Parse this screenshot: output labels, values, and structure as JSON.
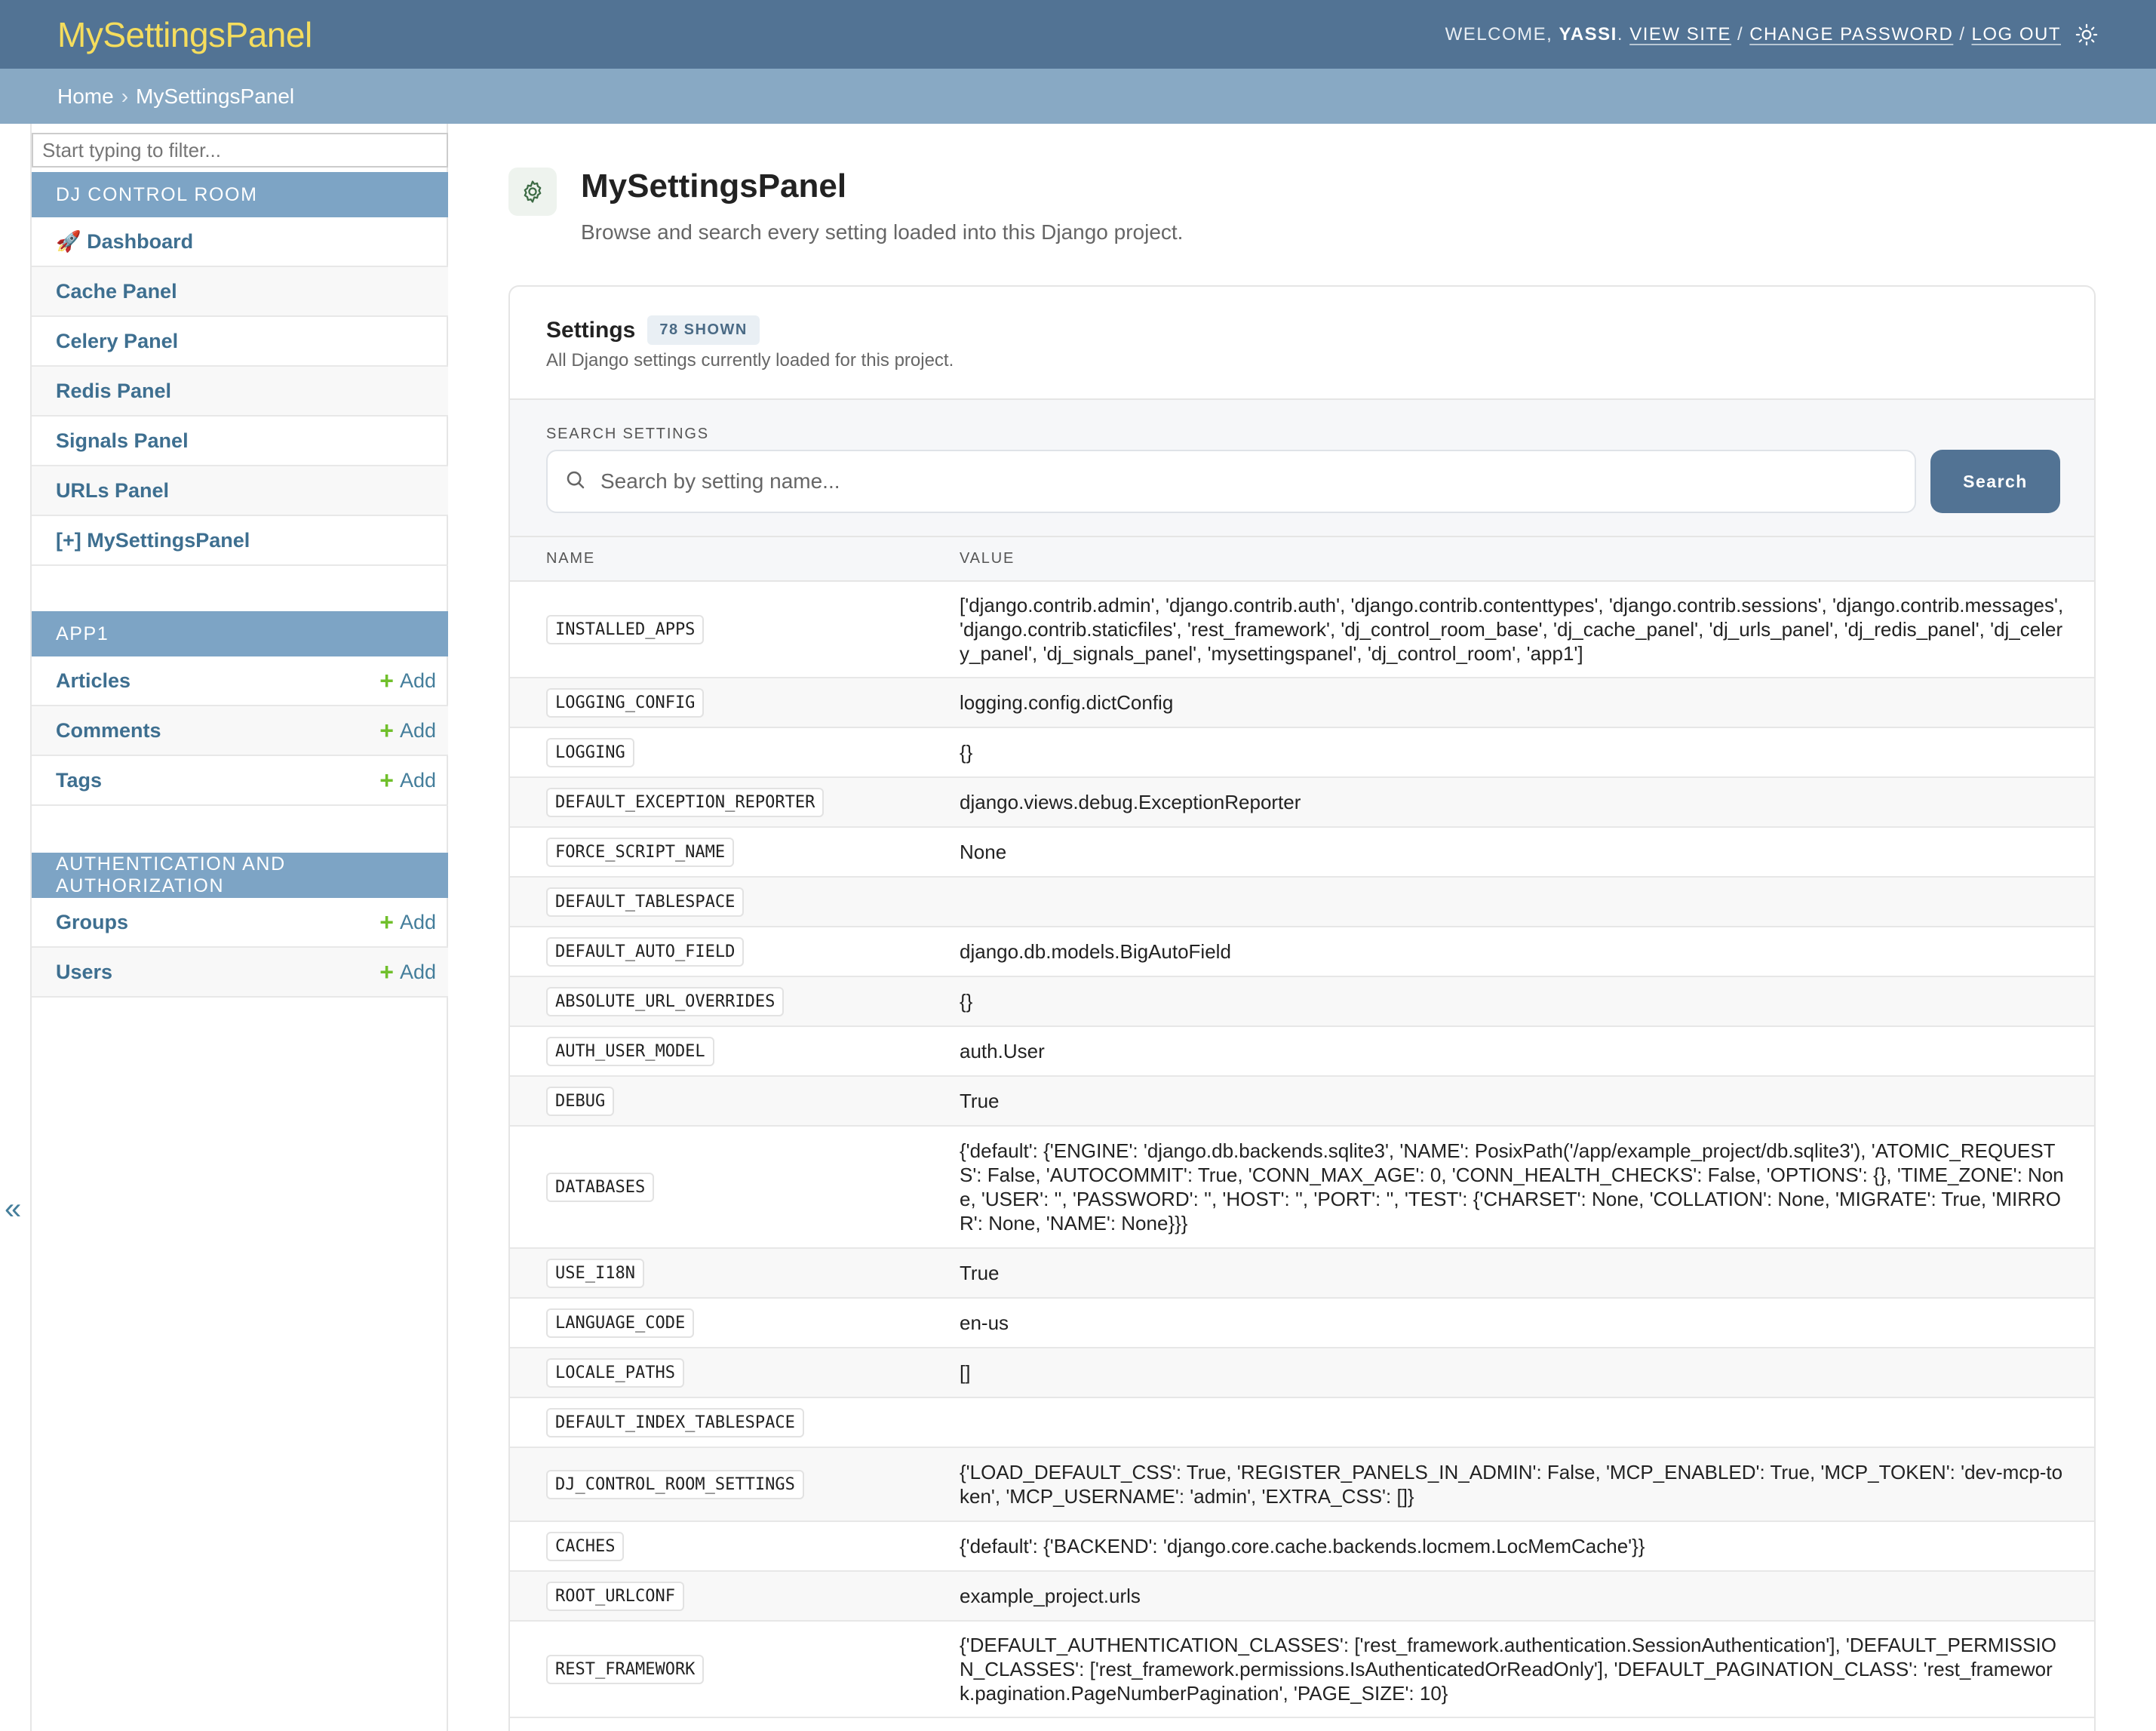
{
  "header": {
    "brand": "MySettingsPanel",
    "welcome_prefix": "WELCOME,",
    "username": "YASSI",
    "view_site": "VIEW SITE",
    "change_password": "CHANGE PASSWORD",
    "log_out": "LOG OUT",
    "separator": "/",
    "theme_icon": "sun-icon"
  },
  "breadcrumbs": {
    "home": "Home",
    "separator": "›",
    "current": "MySettingsPanel"
  },
  "sidebar": {
    "filter_placeholder": "Start typing to filter...",
    "collapse_label": "«",
    "modules": [
      {
        "caption": "DJ CONTROL ROOM",
        "items": [
          {
            "label": "🚀 Dashboard"
          },
          {
            "label": "Cache Panel"
          },
          {
            "label": "Celery Panel"
          },
          {
            "label": "Redis Panel"
          },
          {
            "label": "Signals Panel"
          },
          {
            "label": "URLs Panel"
          },
          {
            "label": "[+] MySettingsPanel"
          }
        ]
      },
      {
        "caption": "APP1",
        "items": [
          {
            "label": "Articles",
            "add": "Add"
          },
          {
            "label": "Comments",
            "add": "Add"
          },
          {
            "label": "Tags",
            "add": "Add"
          }
        ]
      },
      {
        "caption": "AUTHENTICATION AND AUTHORIZATION",
        "items": [
          {
            "label": "Groups",
            "add": "Add"
          },
          {
            "label": "Users",
            "add": "Add"
          }
        ]
      }
    ],
    "add_plus": "+"
  },
  "main": {
    "title": "MySettingsPanel",
    "subtitle": "Browse and search every setting loaded into this Django project.",
    "icon": "gear-icon",
    "card": {
      "title": "Settings",
      "badge": "78 SHOWN",
      "description": "All Django settings currently loaded for this project.",
      "search_label": "SEARCH SETTINGS",
      "search_placeholder": "Search by setting name...",
      "search_button": "Search",
      "columns": {
        "name": "NAME",
        "value": "VALUE"
      },
      "rows": [
        {
          "name": "INSTALLED_APPS",
          "value": "['django.contrib.admin', 'django.contrib.auth', 'django.contrib.contenttypes', 'django.contrib.sessions', 'django.contrib.messages', 'django.contrib.staticfiles', 'rest_framework', 'dj_control_room_base', 'dj_cache_panel', 'dj_urls_panel', 'dj_redis_panel', 'dj_celery_panel', 'dj_signals_panel', 'mysettingspanel', 'dj_control_room', 'app1']"
        },
        {
          "name": "LOGGING_CONFIG",
          "value": "logging.config.dictConfig"
        },
        {
          "name": "LOGGING",
          "value": "{}"
        },
        {
          "name": "DEFAULT_EXCEPTION_REPORTER",
          "value": "django.views.debug.ExceptionReporter"
        },
        {
          "name": "FORCE_SCRIPT_NAME",
          "value": "None"
        },
        {
          "name": "DEFAULT_TABLESPACE",
          "value": ""
        },
        {
          "name": "DEFAULT_AUTO_FIELD",
          "value": "django.db.models.BigAutoField"
        },
        {
          "name": "ABSOLUTE_URL_OVERRIDES",
          "value": "{}"
        },
        {
          "name": "AUTH_USER_MODEL",
          "value": "auth.User"
        },
        {
          "name": "DEBUG",
          "value": "True"
        },
        {
          "name": "DATABASES",
          "value": "{'default': {'ENGINE': 'django.db.backends.sqlite3', 'NAME': PosixPath('/app/example_project/db.sqlite3'), 'ATOMIC_REQUESTS': False, 'AUTOCOMMIT': True, 'CONN_MAX_AGE': 0, 'CONN_HEALTH_CHECKS': False, 'OPTIONS': {}, 'TIME_ZONE': None, 'USER': '', 'PASSWORD': '', 'HOST': '', 'PORT': '', 'TEST': {'CHARSET': None, 'COLLATION': None, 'MIGRATE': True, 'MIRROR': None, 'NAME': None}}}"
        },
        {
          "name": "USE_I18N",
          "value": "True"
        },
        {
          "name": "LANGUAGE_CODE",
          "value": "en-us"
        },
        {
          "name": "LOCALE_PATHS",
          "value": "[]"
        },
        {
          "name": "DEFAULT_INDEX_TABLESPACE",
          "value": ""
        },
        {
          "name": "DJ_CONTROL_ROOM_SETTINGS",
          "value": "{'LOAD_DEFAULT_CSS': True, 'REGISTER_PANELS_IN_ADMIN': False, 'MCP_ENABLED': True, 'MCP_TOKEN': 'dev-mcp-token', 'MCP_USERNAME': 'admin', 'EXTRA_CSS': []}"
        },
        {
          "name": "CACHES",
          "value": "{'default': {'BACKEND': 'django.core.cache.backends.locmem.LocMemCache'}}"
        },
        {
          "name": "ROOT_URLCONF",
          "value": "example_project.urls"
        },
        {
          "name": "REST_FRAMEWORK",
          "value": "{'DEFAULT_AUTHENTICATION_CLASSES': ['rest_framework.authentication.SessionAuthentication'], 'DEFAULT_PERMISSION_CLASSES': ['rest_framework.permissions.IsAuthenticatedOrReadOnly'], 'DEFAULT_PAGINATION_CLASS': 'rest_framework.pagination.PageNumberPagination', 'PAGE_SIZE': 10}"
        }
      ]
    }
  }
}
